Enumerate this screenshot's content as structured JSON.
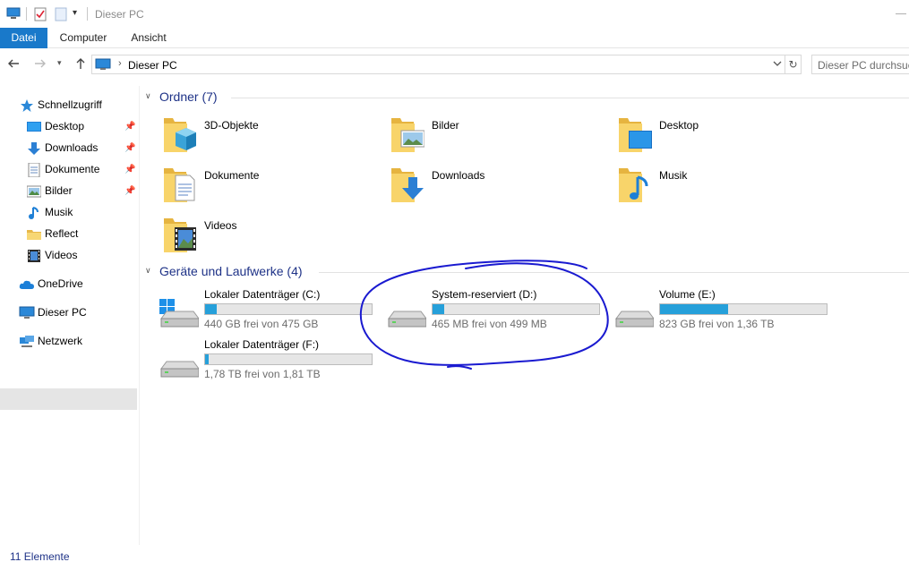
{
  "window": {
    "title": "Dieser PC"
  },
  "ribbon": {
    "tabs": [
      "Datei",
      "Computer",
      "Ansicht"
    ]
  },
  "address": {
    "location": "Dieser PC",
    "search_placeholder": "Dieser PC durchsuchen"
  },
  "sidebar": {
    "items": [
      {
        "label": "Schnellzugriff",
        "icon": "star-icon",
        "pinned": false
      },
      {
        "label": "Desktop",
        "icon": "desktop-icon",
        "pinned": true
      },
      {
        "label": "Downloads",
        "icon": "download-arrow-icon",
        "pinned": true
      },
      {
        "label": "Dokumente",
        "icon": "document-icon",
        "pinned": true
      },
      {
        "label": "Bilder",
        "icon": "pictures-icon",
        "pinned": true
      },
      {
        "label": "Musik",
        "icon": "music-note-icon",
        "pinned": false
      },
      {
        "label": "Reflect",
        "icon": "folder-icon",
        "pinned": false
      },
      {
        "label": "Videos",
        "icon": "video-icon",
        "pinned": false
      },
      {
        "label": "OneDrive",
        "icon": "cloud-icon",
        "pinned": false
      },
      {
        "label": "Dieser PC",
        "icon": "computer-icon",
        "pinned": false,
        "selected": true
      },
      {
        "label": "Netzwerk",
        "icon": "network-icon",
        "pinned": false
      }
    ]
  },
  "groups": {
    "folders_title": "Ordner (7)",
    "drives_title": "Geräte und Laufwerke (4)"
  },
  "folders": [
    {
      "label": "3D-Objekte",
      "icon": "3d-objects-icon"
    },
    {
      "label": "Bilder",
      "icon": "pictures-folder-icon"
    },
    {
      "label": "Desktop",
      "icon": "desktop-folder-icon"
    },
    {
      "label": "Dokumente",
      "icon": "documents-folder-icon"
    },
    {
      "label": "Downloads",
      "icon": "downloads-folder-icon"
    },
    {
      "label": "Musik",
      "icon": "music-folder-icon"
    },
    {
      "label": "Videos",
      "icon": "videos-folder-icon"
    }
  ],
  "drives": [
    {
      "name": "Lokaler Datenträger (C:)",
      "free": "440 GB frei von 475 GB",
      "used_fraction": 0.07,
      "icon": "windows-drive-icon"
    },
    {
      "name": "System-reserviert (D:)",
      "free": "465 MB frei von 499 MB",
      "used_fraction": 0.07,
      "icon": "hard-drive-icon"
    },
    {
      "name": "Volume (E:)",
      "free": "823 GB frei von 1,36 TB",
      "used_fraction": 0.41,
      "icon": "hard-drive-icon"
    },
    {
      "name": "Lokaler Datenträger (F:)",
      "free": "1,78 TB frei von 1,81 TB",
      "used_fraction": 0.02,
      "icon": "hard-drive-icon"
    }
  ],
  "status": {
    "count": "11 Elemente"
  },
  "colors": {
    "accent": "#1979ca",
    "bar_fill": "#26a0da",
    "annotation": "#1a1ad0"
  }
}
